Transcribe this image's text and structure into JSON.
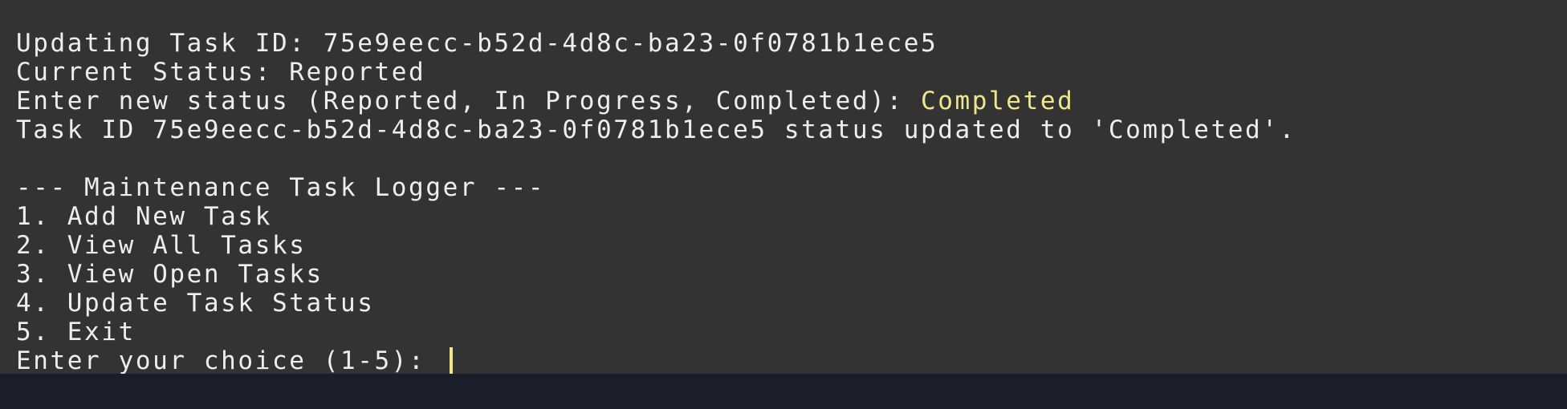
{
  "colors": {
    "terminal_bg": "#333333",
    "text": "#eeeeee",
    "user_input": "#f0e68c",
    "cursor": "#f0e68c",
    "bottom_strip": "#1b1d29"
  },
  "output": {
    "update_line": "Updating Task ID: 75e9eecc-b52d-4d8c-ba23-0f0781b1ece5",
    "current_status": "Current Status: Reported",
    "status_prompt": "Enter new status (Reported, In Progress, Completed): ",
    "status_input": "Completed",
    "confirmation": "Task ID 75e9eecc-b52d-4d8c-ba23-0f0781b1ece5 status updated to 'Completed'."
  },
  "menu": {
    "header": "--- Maintenance Task Logger ---",
    "items": [
      "1. Add New Task",
      "2. View All Tasks",
      "3. View Open Tasks",
      "4. Update Task Status",
      "5. Exit"
    ],
    "choice_prompt": "Enter your choice (1-5): "
  }
}
